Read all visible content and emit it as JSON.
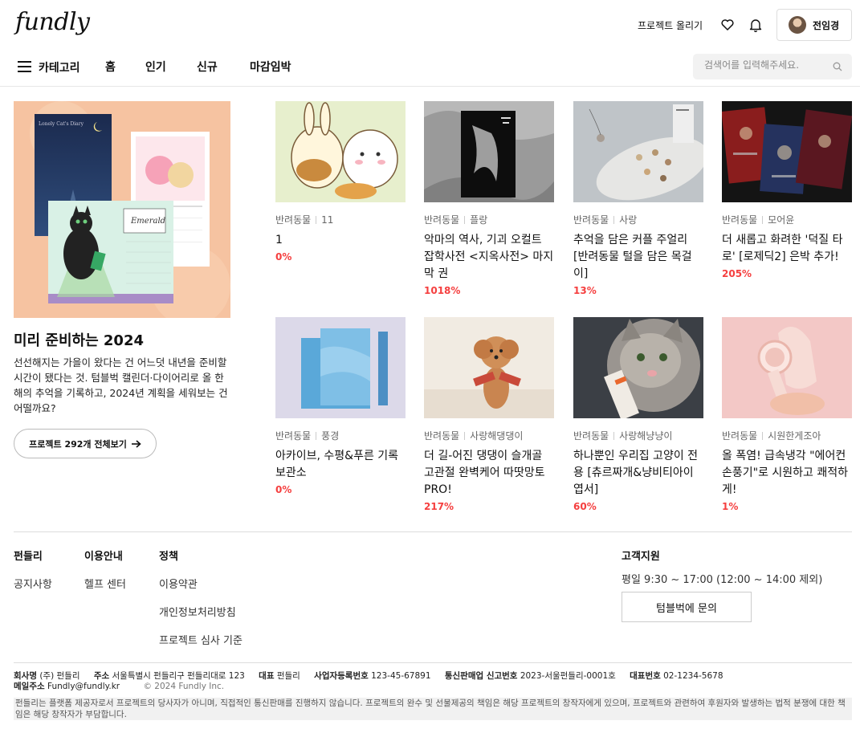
{
  "header": {
    "logo": "fundly",
    "upload_label": "프로젝트 올리기",
    "user_name": "전임경"
  },
  "nav": {
    "category_label": "카테고리",
    "items": [
      "홈",
      "인기",
      "신규",
      "마감임박"
    ],
    "search_placeholder": "검색어를 입력해주세요."
  },
  "feature": {
    "title": "미리 준비하는 2024",
    "description": "선선해지는 가을이 왔다는 건 어느덧 내년을 준비할 시간이 됐다는 것. 텀블벅 캘린더·다이어리로 올 한해의 추억을 기록하고, 2024년 계획을 세워보는 건 어떨까요?",
    "button_label": "프로젝트 292개 전체보기",
    "calendar_label": "Emerald",
    "book_label": "Lonely Cat's Diary"
  },
  "cards": [
    {
      "category": "반려동물",
      "creator": "11",
      "title": "1",
      "rate": "0%"
    },
    {
      "category": "반려동물",
      "creator": "플랑",
      "title": "악마의 역사, 기괴 오컬트 잡학사전 <지옥사전> 마지막 권",
      "rate": "1018%"
    },
    {
      "category": "반려동물",
      "creator": "사랑",
      "title": "추억을 담은 커플 주얼리 [반려동물 털을 담은 목걸이]",
      "rate": "13%"
    },
    {
      "category": "반려동물",
      "creator": "모어윤",
      "title": "더 새롭고 화려한 '덕질 타로' [로제딕2] 은박 추가!",
      "rate": "205%"
    },
    {
      "category": "반려동물",
      "creator": "풍경",
      "title": "아카이브, 수평&푸른 기록 보관소",
      "rate": "0%"
    },
    {
      "category": "반려동물",
      "creator": "사랑해댕댕이",
      "title": "더 길-어진 댕댕이 슬개골 고관절 완벽케어 따땃망토PRO!",
      "rate": "217%"
    },
    {
      "category": "반려동물",
      "creator": "사랑해냥냥이",
      "title": "하나뿐인 우리집 고양이 전용 [츄르짜개&냥비티아이 엽서]",
      "rate": "60%"
    },
    {
      "category": "반려동물",
      "creator": "시원한게조아",
      "title": "올 폭염! 급속냉각 \"에어컨 손풍기\"로 시원하고 쾌적하게!",
      "rate": "1%"
    }
  ],
  "footer": {
    "col1": {
      "title": "펀들리",
      "links": [
        "공지사항"
      ]
    },
    "col2": {
      "title": "이용안내",
      "links": [
        "헬프 센터"
      ]
    },
    "col3": {
      "title": "정책",
      "links": [
        "이용약관",
        "개인정보처리방침",
        "프로젝트 심사 기준"
      ]
    },
    "support": {
      "title": "고객지원",
      "hours": "평일 9:30 ~ 17:00 (12:00 ~ 14:00 제외)",
      "button": "텀블벅에 문의"
    },
    "company": {
      "name_label": "회사명",
      "name": "(주) 펀들리",
      "addr_label": "주소",
      "addr": "서울특별시 펀들리구 펀들리대로 123",
      "ceo_label": "대표",
      "ceo": "펀들리",
      "biz_label": "사업자등록번호",
      "biz": "123-45-67891",
      "mail_order_label": "통신판매업 신고번호",
      "mail_order": "2023-서울펀들리-0001호",
      "phone_label": "대표번호",
      "phone": "02-1234-5678",
      "email_label": "메일주소",
      "email": "Fundly@fundly.kr",
      "copyright": "© 2024 Fundly Inc."
    },
    "disclaimer": "펀들리는 플랫폼 제공자로서 프로젝트의 당사자가 아니며, 직접적인 통신판매를 진행하지 않습니다. 프로젝트의 완수 및 선물제공의 책임은 해당 프로젝트의 창작자에게 있으며, 프로젝트와 관련하여 후원자와 발생하는 법적 분쟁에 대한 책임은 해당 창작자가 부담합니다."
  },
  "colors": {
    "accent_rate": "#f53f3f"
  }
}
